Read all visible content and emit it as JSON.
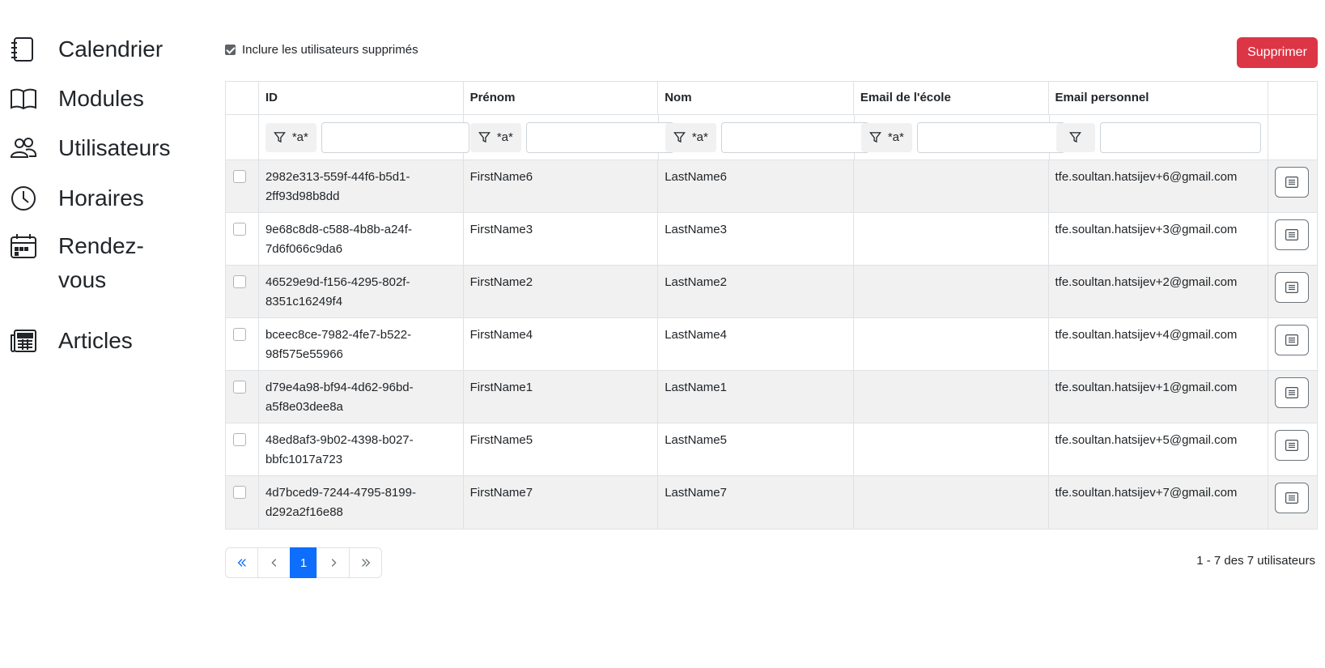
{
  "sidebar": {
    "items": [
      {
        "label": "Calendrier",
        "icon": "notebook-icon"
      },
      {
        "label": "Modules",
        "icon": "book-icon"
      },
      {
        "label": "Utilisateurs",
        "icon": "users-icon"
      },
      {
        "label": "Horaires",
        "icon": "clock-icon"
      },
      {
        "label": "Rendez-vous",
        "icon": "calendar-icon"
      },
      {
        "label": "Articles",
        "icon": "newspaper-icon"
      }
    ]
  },
  "toolbar": {
    "include_deleted_label": "Inclure les utilisateurs supprimés",
    "include_deleted_checked": true,
    "delete_label": "Supprimer",
    "delete_color": "#dc3545"
  },
  "table": {
    "headers": [
      "ID",
      "Prénom",
      "Nom",
      "Email de l'école",
      "Email personnel"
    ],
    "filters": [
      "*a*",
      "*a*",
      "*a*",
      "*a*",
      ""
    ],
    "rows": [
      {
        "id": "2982e313-559f-44f6-b5d1-2ff93d98b8dd",
        "first": "FirstName6",
        "last": "LastName6",
        "school_email": "",
        "personal_email": "tfe.soultan.hatsijev+6@gmail.com"
      },
      {
        "id": "9e68c8d8-c588-4b8b-a24f-7d6f066c9da6",
        "first": "FirstName3",
        "last": "LastName3",
        "school_email": "",
        "personal_email": "tfe.soultan.hatsijev+3@gmail.com"
      },
      {
        "id": "46529e9d-f156-4295-802f-8351c16249f4",
        "first": "FirstName2",
        "last": "LastName2",
        "school_email": "",
        "personal_email": "tfe.soultan.hatsijev+2@gmail.com"
      },
      {
        "id": "bceec8ce-7982-4fe7-b522-98f575e55966",
        "first": "FirstName4",
        "last": "LastName4",
        "school_email": "",
        "personal_email": "tfe.soultan.hatsijev+4@gmail.com"
      },
      {
        "id": "d79e4a98-bf94-4d62-96bd-a5f8e03dee8a",
        "first": "FirstName1",
        "last": "LastName1",
        "school_email": "",
        "personal_email": "tfe.soultan.hatsijev+1@gmail.com"
      },
      {
        "id": "48ed8af3-9b02-4398-b027-bbfc1017a723",
        "first": "FirstName5",
        "last": "LastName5",
        "school_email": "",
        "personal_email": "tfe.soultan.hatsijev+5@gmail.com"
      },
      {
        "id": "4d7bced9-7244-4795-8199-d292a2f16e88",
        "first": "FirstName7",
        "last": "LastName7",
        "school_email": "",
        "personal_email": "tfe.soultan.hatsijev+7@gmail.com"
      }
    ]
  },
  "pager": {
    "current_page": "1",
    "summary": "1 - 7 des 7 utilisateurs",
    "accent": "#0d6efd"
  }
}
